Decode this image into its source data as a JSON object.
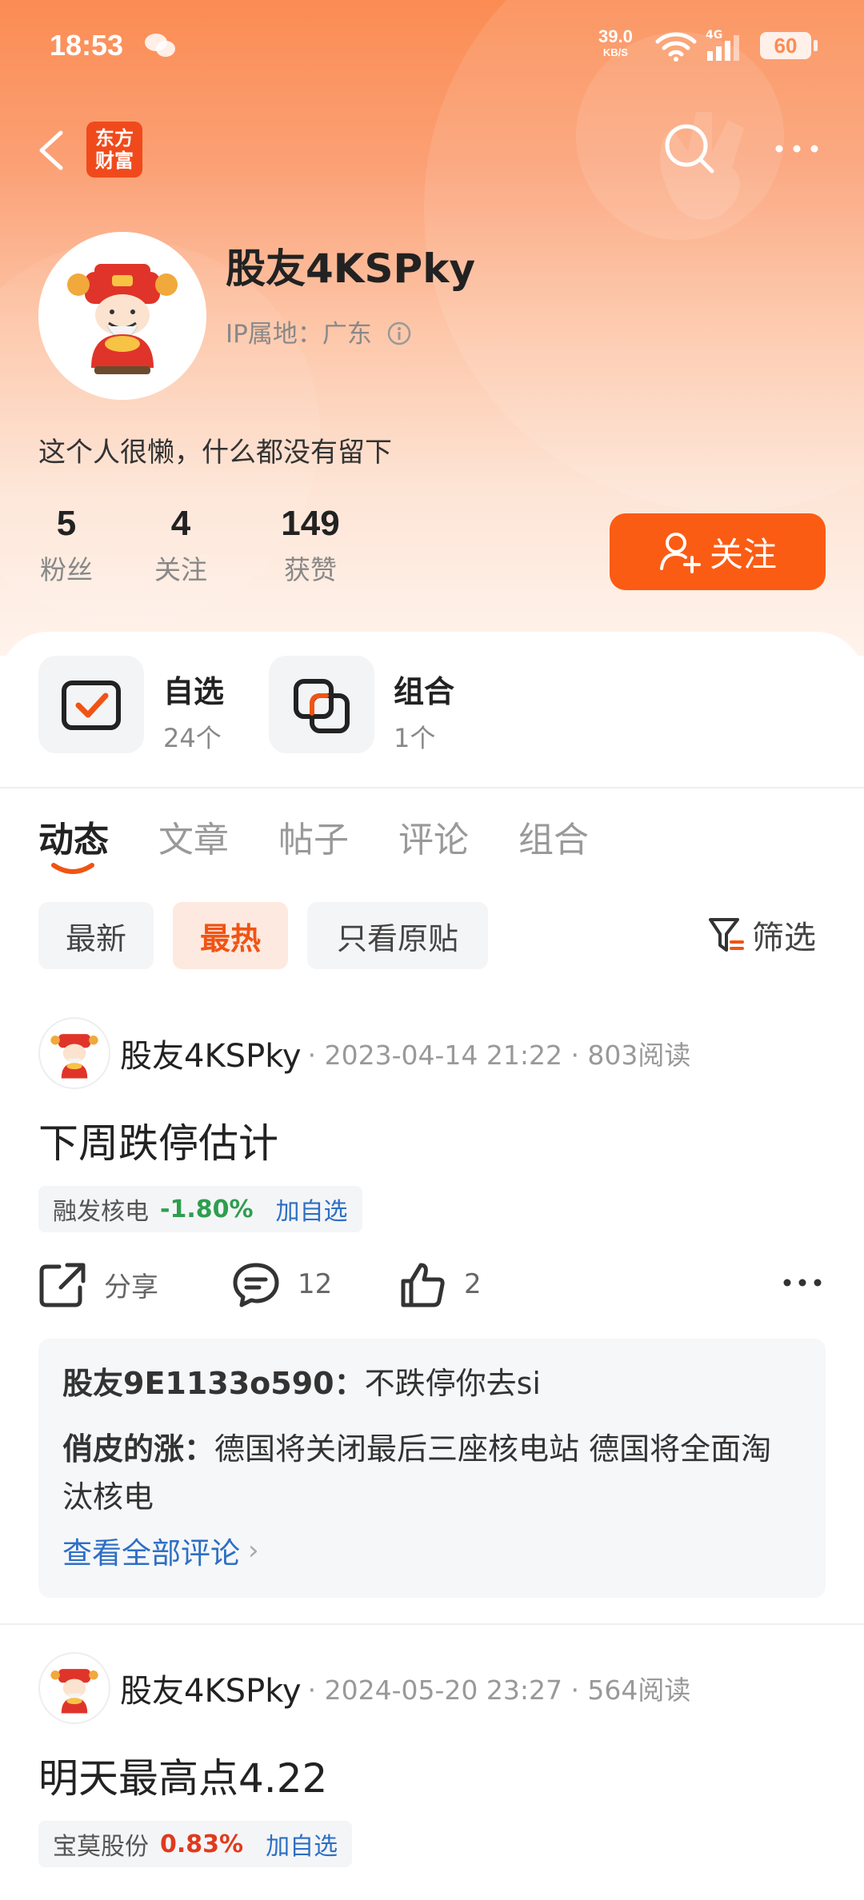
{
  "status_bar": {
    "time": "18:53",
    "net_speed": "39.0",
    "net_unit": "KB/S",
    "signal_label": "4G",
    "battery": "60"
  },
  "nav": {
    "logo_line1": "东方",
    "logo_line2": "财富"
  },
  "profile": {
    "username": "股友4KSPky",
    "ip_label": "IP属地：广东",
    "bio": "这个人很懒，什么都没有留下",
    "stats": [
      {
        "num": "5",
        "label": "粉丝"
      },
      {
        "num": "4",
        "label": "关注"
      },
      {
        "num": "149",
        "label": "获赞"
      }
    ],
    "follow_label": "关注"
  },
  "quick": {
    "watchlist": {
      "title": "自选",
      "count": "24个"
    },
    "portfolio": {
      "title": "组合",
      "count": "1个"
    }
  },
  "tabs": [
    "动态",
    "文章",
    "帖子",
    "评论",
    "组合"
  ],
  "filters": [
    "最新",
    "最热",
    "只看原贴"
  ],
  "filter_button": "筛选",
  "colors": {
    "accent": "#fb5c14",
    "down": "#2e9e4f",
    "up": "#e03a1e",
    "link": "#2d6fc4"
  },
  "posts": [
    {
      "author": "股友4KSPky",
      "meta": "· 2023-04-14 21:22 · 803阅读",
      "title": "下周跌停估计",
      "stock": {
        "name": "融发核电",
        "change": "-1.80%",
        "add": "加自选"
      },
      "share_label": "分享",
      "comments_count": "12",
      "likes_count": "2",
      "comments": [
        {
          "user": "股友9E1133o590：",
          "text": "不跌停你去si"
        },
        {
          "user": "俏皮的涨：",
          "text": "德国将关闭最后三座核电站 德国将全面淘汰核电"
        }
      ],
      "view_all": "查看全部评论"
    },
    {
      "author": "股友4KSPky",
      "meta": "· 2024-05-20 23:27 · 564阅读",
      "title": "明天最高点4.22",
      "stock": {
        "name": "宝莫股份",
        "change": "0.83%",
        "add": "加自选"
      }
    }
  ]
}
